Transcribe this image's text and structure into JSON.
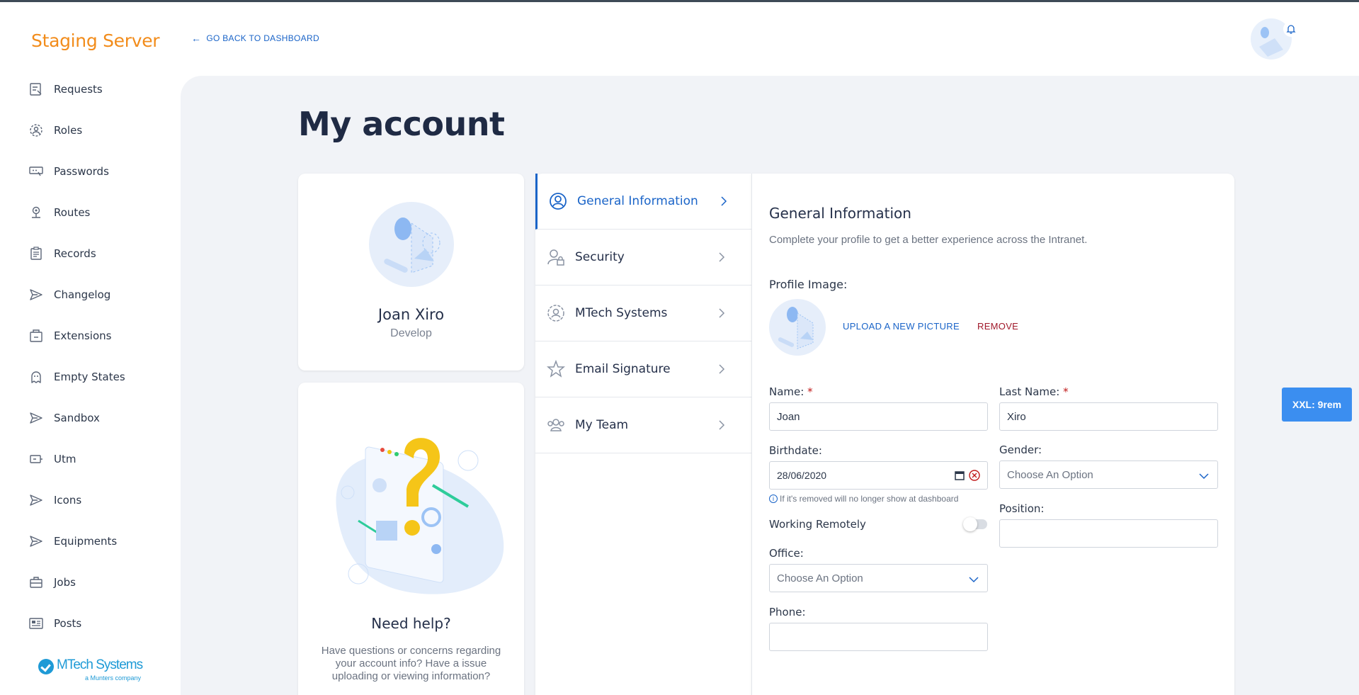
{
  "app": {
    "brand": "Staging Server"
  },
  "header": {
    "back_label": "GO BACK TO DASHBOARD"
  },
  "sidebar": {
    "items": [
      {
        "label": "Requests",
        "icon": "requests-icon"
      },
      {
        "label": "Roles",
        "icon": "roles-icon"
      },
      {
        "label": "Passwords",
        "icon": "passwords-icon"
      },
      {
        "label": "Routes",
        "icon": "routes-icon"
      },
      {
        "label": "Records",
        "icon": "records-icon"
      },
      {
        "label": "Changelog",
        "icon": "send-icon"
      },
      {
        "label": "Extensions",
        "icon": "extensions-icon"
      },
      {
        "label": "Empty States",
        "icon": "ghost-icon"
      },
      {
        "label": "Sandbox",
        "icon": "send-icon"
      },
      {
        "label": "Utm",
        "icon": "utm-icon"
      },
      {
        "label": "Icons",
        "icon": "send-icon"
      },
      {
        "label": "Equipments",
        "icon": "send-icon"
      },
      {
        "label": "Jobs",
        "icon": "briefcase-icon"
      },
      {
        "label": "Posts",
        "icon": "posts-icon"
      }
    ],
    "logo": {
      "name": "MTech Systems",
      "sub": "a Munters company"
    }
  },
  "page": {
    "title": "My account"
  },
  "profile": {
    "name": "Joan Xiro",
    "role": "Develop"
  },
  "help": {
    "title": "Need help?",
    "text": "Have questions or concerns regarding your account info? Have a issue uploading or viewing information?"
  },
  "menu": {
    "items": [
      {
        "label": "General Information",
        "active": true
      },
      {
        "label": "Security",
        "active": false
      },
      {
        "label": "MTech Systems",
        "active": false
      },
      {
        "label": "Email Signature",
        "active": false
      },
      {
        "label": "My Team",
        "active": false
      }
    ]
  },
  "form": {
    "title": "General Information",
    "subtitle": "Complete your profile to get a better experience across the Intranet.",
    "profile_image_label": "Profile Image:",
    "upload_label": "UPLOAD A NEW PICTURE",
    "remove_label": "REMOVE",
    "name_label": "Name:",
    "name_value": "Joan",
    "last_name_label": "Last Name:",
    "last_name_value": "Xiro",
    "required_mark": "*",
    "birthdate_label": "Birthdate:",
    "birthdate_value": "28/06/2020",
    "birthdate_hint": "If it's removed will no longer show at dashboard",
    "gender_label": "Gender:",
    "gender_value": "Choose An Option",
    "working_remotely_label": "Working Remotely",
    "working_remotely_on": false,
    "position_label": "Position:",
    "position_value": "",
    "office_label": "Office:",
    "office_value": "Choose An Option",
    "phone_label": "Phone:",
    "phone_value": ""
  },
  "badge": {
    "breakpoint": "XXL: 9rem"
  },
  "colors": {
    "brand": "#f28c1b",
    "accent": "#1a64c8",
    "danger": "#a0182a",
    "badge": "#3b8ef0"
  }
}
